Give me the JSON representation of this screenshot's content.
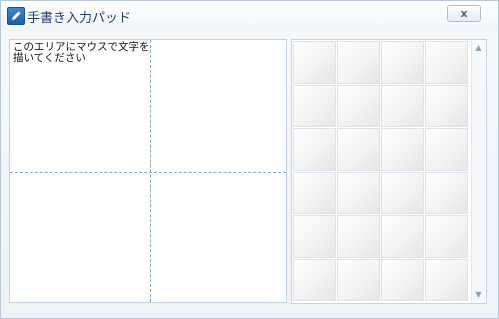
{
  "window": {
    "title": "手書き入力パッド",
    "close_label": "x"
  },
  "draw_area": {
    "hint": "このエリアにマウスで文字を描いてください"
  },
  "candidates": {
    "rows": 6,
    "columns": 4,
    "cells": [
      "",
      "",
      "",
      "",
      "",
      "",
      "",
      "",
      "",
      "",
      "",
      "",
      "",
      "",
      "",
      "",
      "",
      "",
      "",
      "",
      "",
      "",
      "",
      ""
    ]
  },
  "scrollbar": {
    "up_icon": "scroll-up-arrow",
    "down_icon": "scroll-down-arrow"
  },
  "icons": {
    "app": "pencil-icon"
  }
}
